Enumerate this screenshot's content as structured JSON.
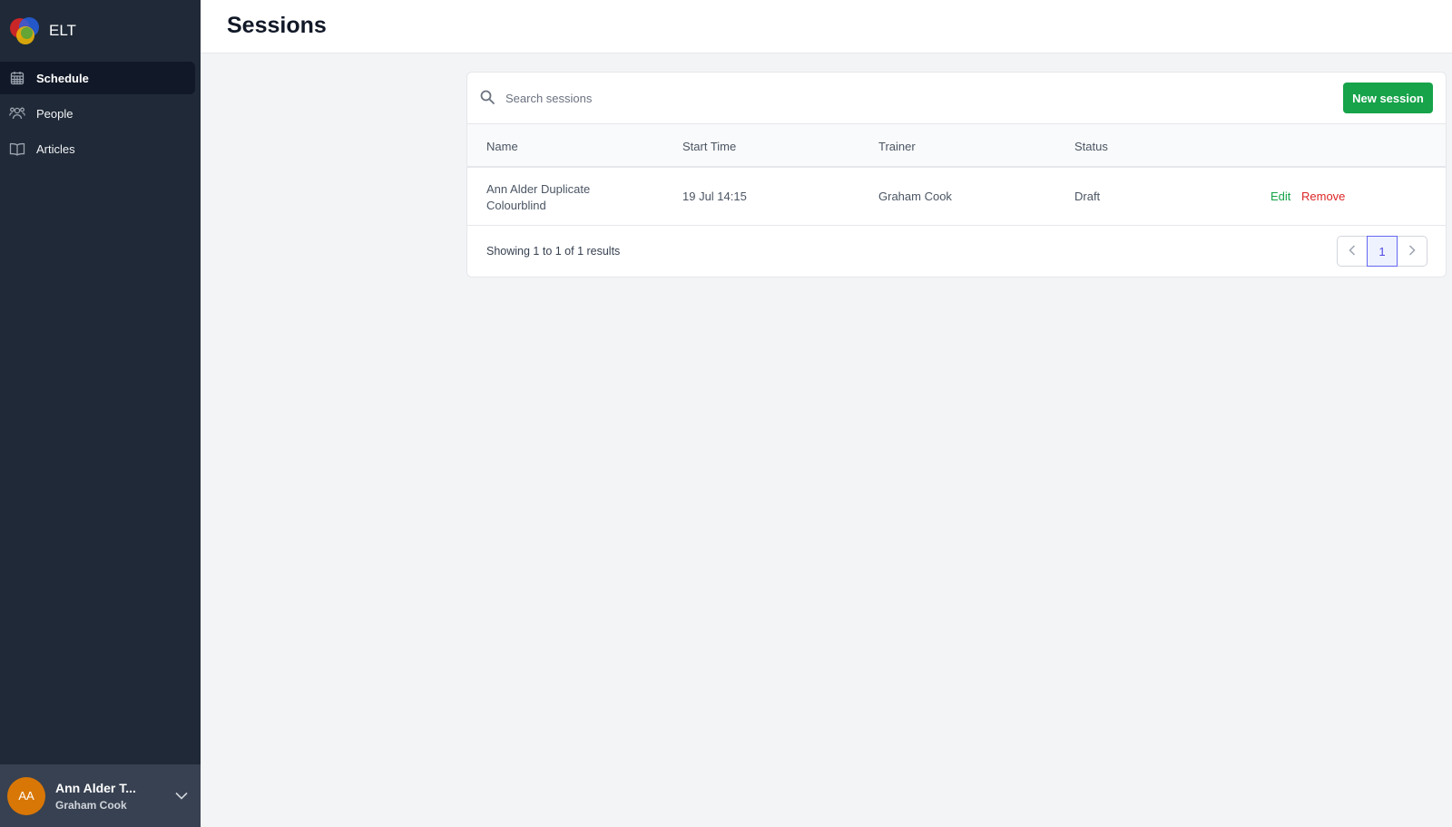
{
  "app": {
    "name": "ELT"
  },
  "sidebar": {
    "items": [
      {
        "label": "Schedule",
        "icon": "calendar-icon",
        "active": true
      },
      {
        "label": "People",
        "icon": "users-icon",
        "active": false
      },
      {
        "label": "Articles",
        "icon": "book-open-icon",
        "active": false
      }
    ]
  },
  "user": {
    "initials": "AA",
    "name": "Ann Alder T...",
    "subtitle": "Graham Cook",
    "avatar_color": "#d97706"
  },
  "header": {
    "title": "Sessions"
  },
  "search": {
    "placeholder": "Search sessions",
    "value": ""
  },
  "toolbar": {
    "new_label": "New session",
    "accent": "#16a34a"
  },
  "table": {
    "columns": [
      "Name",
      "Start Time",
      "Trainer",
      "Status"
    ],
    "rows": [
      {
        "name": "Ann Alder Duplicate Colourblind",
        "start_time": "19 Jul 14:15",
        "trainer": "Graham Cook",
        "status": "Draft",
        "edit_label": "Edit",
        "remove_label": "Remove"
      }
    ]
  },
  "pagination": {
    "summary": "Showing 1 to 1 of 1 results",
    "current_page": "1"
  }
}
